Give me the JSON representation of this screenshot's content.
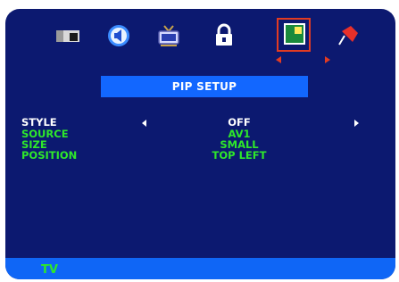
{
  "colors": {
    "panel": "#0c1970",
    "accent": "#1267ff",
    "status": "#0f66f6",
    "highlight": "#e23b22",
    "value_green": "#2ee82a"
  },
  "tabs": [
    {
      "icon": "picture-icon"
    },
    {
      "icon": "sound-icon"
    },
    {
      "icon": "tv-channel-icon"
    },
    {
      "icon": "lock-icon"
    },
    {
      "icon": "pip-icon",
      "selected": true
    },
    {
      "icon": "setup-pin-icon"
    }
  ],
  "menu": {
    "title": "PIP SETUP",
    "rows": [
      {
        "label": "STYLE",
        "value": "OFF"
      },
      {
        "label": "SOURCE",
        "value": "AV1"
      },
      {
        "label": "SIZE",
        "value": "SMALL"
      },
      {
        "label": "POSITION",
        "value": "TOP LEFT"
      }
    ]
  },
  "status": {
    "source": "TV"
  }
}
